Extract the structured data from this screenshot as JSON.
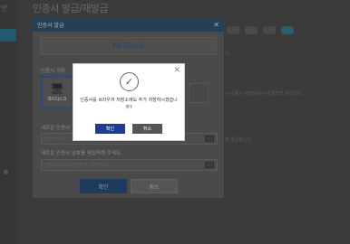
{
  "background": {
    "title": "인증서 발급/재발급",
    "sidebar_text": "안",
    "right_texts": [
      "가.",
      "는 인증서 비밀번호는 변경되지 않습니다.",
      "해 발급합니다."
    ]
  },
  "cert_dialog": {
    "title": "인증서 발급",
    "bank_logo": {
      "nh": "NH",
      "bank": "Bank"
    },
    "save_location_label": "인증서 저장",
    "device_label": "하드디스크",
    "new_password_label": "새로운 인증서",
    "new_password_placeholder": "인증서 암호",
    "confirm_label": "새로운 인증서 암호를 재입력해 주세요.",
    "confirm_placeholder": "인증서 암호 다시 한번 더 입력합니다.",
    "ok_label": "확인",
    "cancel_label": "취소"
  },
  "alert": {
    "message": "인증서를 브라우저 저장소에도 추가 저장하시겠습니까?",
    "ok_label": "확인",
    "cancel_label": "취소"
  },
  "colors": {
    "primary_button": "#1d3d94",
    "secondary_button": "#555555",
    "dialog_header": "#273f55"
  },
  "icons": {
    "alert_icon": "check-circle-icon",
    "device_icon": "monitor-icon",
    "keyboard_icon": "keyboard-icon"
  }
}
